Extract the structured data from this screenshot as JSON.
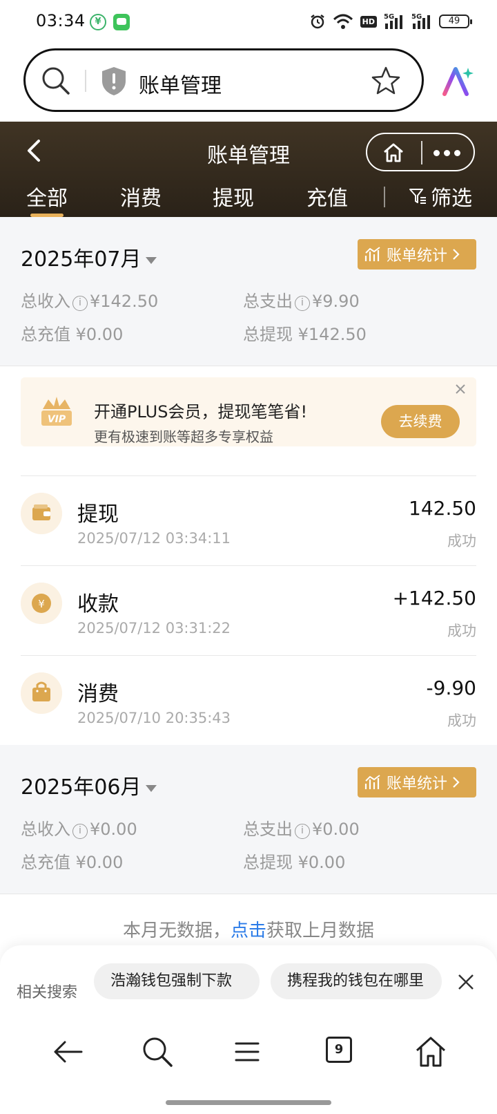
{
  "status_bar": {
    "time": "03:34",
    "battery": "49",
    "hd": "HD",
    "net1": "5G",
    "net2": "5G"
  },
  "browser": {
    "search_text": "账单管理"
  },
  "header": {
    "title": "账单管理"
  },
  "tabs": [
    {
      "label": "全部",
      "active": true
    },
    {
      "label": "消费",
      "active": false
    },
    {
      "label": "提现",
      "active": false
    },
    {
      "label": "充值",
      "active": false
    }
  ],
  "filter_label": "筛选",
  "months": [
    {
      "title": "2025年07月",
      "stat_button": "账单统计",
      "income_label": "总收入",
      "income": "¥142.50",
      "expense_label": "总支出",
      "expense": "¥9.90",
      "recharge_label": "总充值",
      "recharge": "¥0.00",
      "withdraw_label": "总提现",
      "withdraw": "¥142.50"
    },
    {
      "title": "2025年06月",
      "stat_button": "账单统计",
      "income_label": "总收入",
      "income": "¥0.00",
      "expense_label": "总支出",
      "expense": "¥0.00",
      "recharge_label": "总充值",
      "recharge": "¥0.00",
      "withdraw_label": "总提现",
      "withdraw": "¥0.00"
    }
  ],
  "promo": {
    "title": "开通PLUS会员，提现笔笔省!",
    "subtitle": "更有极速到账等超多专享权益",
    "button": "去续费",
    "badge": "VIP"
  },
  "transactions": [
    {
      "type": "提现",
      "time": "2025/07/12 03:34:11",
      "amount": "142.50",
      "status": "成功",
      "icon": "wallet-icon"
    },
    {
      "type": "收款",
      "time": "2025/07/12 03:31:22",
      "amount": "+142.50",
      "status": "成功",
      "icon": "yuan-coin-icon"
    },
    {
      "type": "消费",
      "time": "2025/07/10 20:35:43",
      "amount": "-9.90",
      "status": "成功",
      "icon": "shopping-bag-icon"
    }
  ],
  "empty_month": {
    "prefix": "本月无数据，",
    "link": "点击",
    "suffix": "获取上月数据"
  },
  "related": {
    "label": "相关搜索",
    "chips": [
      "浩瀚钱包强制下款",
      "携程我的钱包在哪里"
    ]
  },
  "bottom_nav": {
    "tab_count": "9"
  },
  "colors": {
    "accent": "#dca74f",
    "header_bg": "#3a2f21",
    "link": "#2a7be8"
  }
}
